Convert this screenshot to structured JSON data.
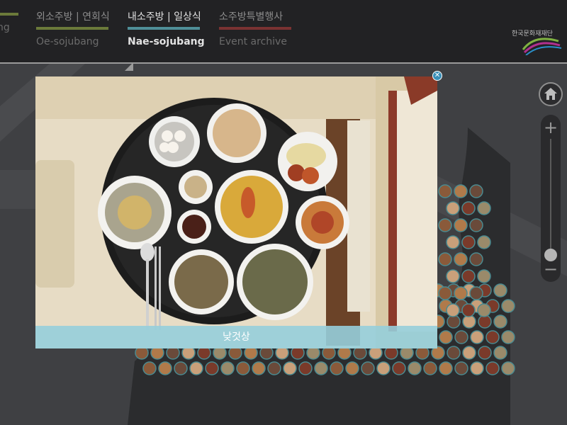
{
  "nav": {
    "items": [
      {
        "ko": "",
        "en": "ng",
        "color": "#6b7a3a"
      },
      {
        "ko": "외소주방 | 연회식",
        "en": "Oe-sojubang",
        "color": "#6b7a3a"
      },
      {
        "ko": "내소주방 | 일상식",
        "en": "Nae-sojubang",
        "color": "#4f8f98"
      },
      {
        "ko": "소주방특별행사",
        "en": "Event archive",
        "color": "#7a3232"
      }
    ],
    "active_index": 2
  },
  "logo": {
    "text": "한국문화재재단"
  },
  "modal": {
    "caption": "낮것상",
    "close_icon": "close-icon"
  },
  "controls": {
    "home_icon": "home-icon",
    "zoom_in_label": "+",
    "zoom_out_label": "−",
    "zoom_level": 0.12
  },
  "colors": {
    "topbar": "#222224",
    "background": "#3f4043",
    "caption_bar": "#96ceda",
    "close_button": "#3a8fb8"
  }
}
